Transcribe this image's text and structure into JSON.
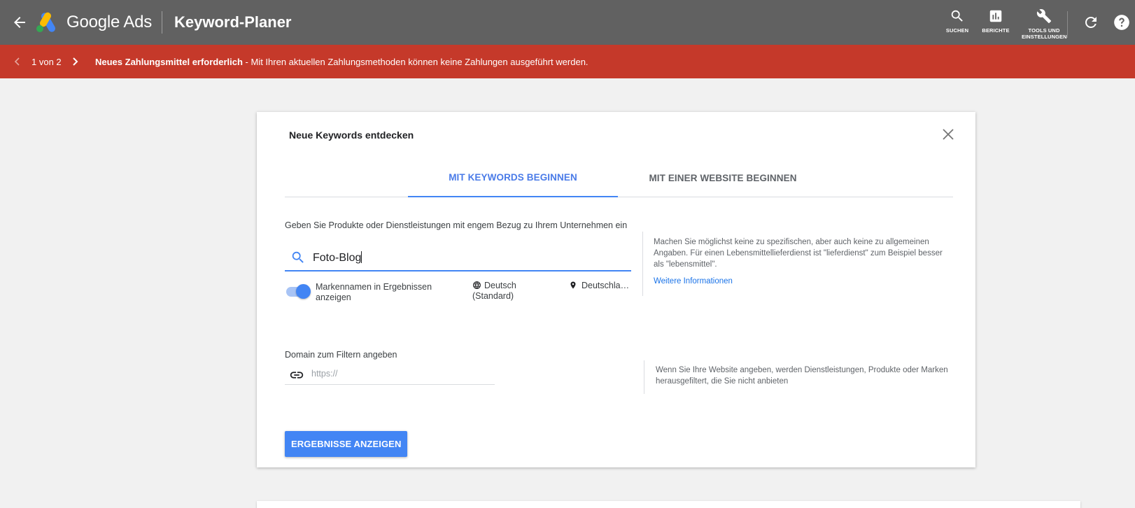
{
  "header": {
    "brand": "Google Ads",
    "page_title": "Keyword-Planer",
    "tools": [
      {
        "label": "SUCHEN",
        "icon": "search-icon"
      },
      {
        "label": "BERICHTE",
        "icon": "bar-chart-icon"
      },
      {
        "label": "TOOLS UND EINSTELLUNGEN",
        "icon": "wrench-icon"
      }
    ]
  },
  "alert": {
    "count": "1 von 2",
    "title": "Neues Zahlungsmittel erforderlich",
    "message": " - Mit Ihren aktuellen Zahlungsmethoden können keine Zahlungen ausgeführt werden.",
    "color": "#c5392a"
  },
  "card": {
    "title": "Neue Keywords entdecken",
    "tabs": [
      {
        "label": "MIT KEYWORDS BEGINNEN",
        "active": true
      },
      {
        "label": "MIT EINER WEBSITE BEGINNEN",
        "active": false
      }
    ],
    "prompt": "Geben Sie Produkte oder Dienstleistungen mit engem Bezug zu Ihrem Unternehmen ein",
    "search_value": "Foto-Blog",
    "toggle_label": "Markennamen in Ergebnissen anzeigen",
    "toggle_on": true,
    "language": "Deutsch (Standard)",
    "location": "Deutschla…",
    "hint1": "Machen Sie möglichst keine zu spezifischen, aber auch keine zu allgemeinen Angaben. Für einen Lebensmittellieferdienst ist \"lieferdienst\" zum Beispiel besser als \"lebensmittel\".",
    "more_info": "Weitere Informationen",
    "domain_label": "Domain zum Filtern angeben",
    "domain_placeholder": "https://",
    "hint2": "Wenn Sie Ihre Website angeben, werden Dienstleistungen, Produkte oder Marken herausgefiltert, die Sie nicht anbieten",
    "submit": "ERGEBNISSE ANZEIGEN"
  },
  "colors": {
    "accent": "#4285f4",
    "topbar": "#616161",
    "link": "#1a73e8"
  }
}
